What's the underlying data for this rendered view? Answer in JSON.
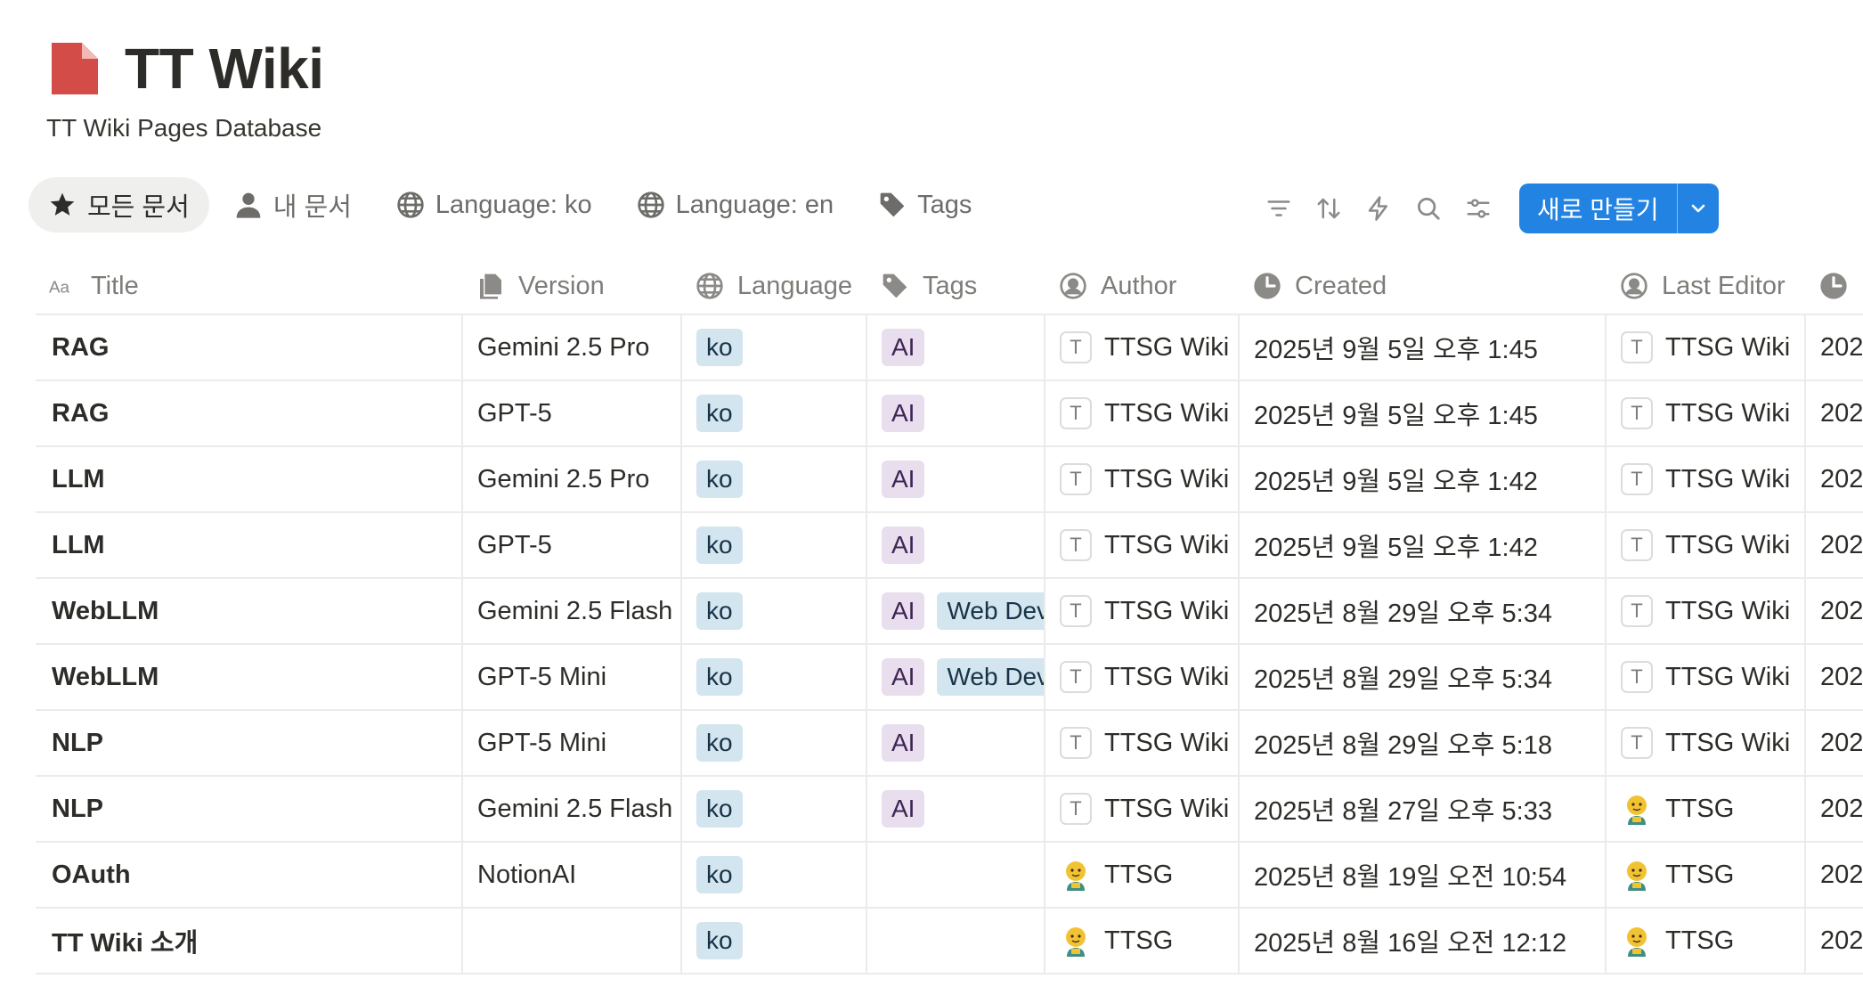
{
  "page": {
    "title": "TT Wiki",
    "subtitle": "TT Wiki Pages Database",
    "icon": "page-icon",
    "icon_color": "#d44c47"
  },
  "views": [
    {
      "label": "모든 문서",
      "icon": "star-icon",
      "active": true
    },
    {
      "label": "내 문서",
      "icon": "person-icon",
      "active": false
    },
    {
      "label": "Language: ko",
      "icon": "globe-icon",
      "active": false
    },
    {
      "label": "Language: en",
      "icon": "globe-icon",
      "active": false
    },
    {
      "label": "Tags",
      "icon": "tag-icon",
      "active": false
    }
  ],
  "toolbar": {
    "icons": [
      "filter-icon",
      "sort-icon",
      "automation-icon",
      "search-icon",
      "settings-icon"
    ],
    "new_label": "새로 만들기",
    "accent": "#2383e2"
  },
  "columns": {
    "title": "Title",
    "version": "Version",
    "language": "Language",
    "tags": "Tags",
    "author": "Author",
    "created": "Created",
    "last_editor": "Last Editor"
  },
  "rows": [
    {
      "title": "RAG",
      "version": "Gemini 2.5 Pro",
      "language": "ko",
      "tags": [
        "AI"
      ],
      "author": "TTSG Wiki",
      "author_avatar": "T",
      "created": "2025년 9월 5일 오후 1:45",
      "editor": "TTSG Wiki",
      "editor_avatar": "T",
      "next": "202"
    },
    {
      "title": "RAG",
      "version": "GPT-5",
      "language": "ko",
      "tags": [
        "AI"
      ],
      "author": "TTSG Wiki",
      "author_avatar": "T",
      "created": "2025년 9월 5일 오후 1:45",
      "editor": "TTSG Wiki",
      "editor_avatar": "T",
      "next": "202"
    },
    {
      "title": "LLM",
      "version": "Gemini 2.5 Pro",
      "language": "ko",
      "tags": [
        "AI"
      ],
      "author": "TTSG Wiki",
      "author_avatar": "T",
      "created": "2025년 9월 5일 오후 1:42",
      "editor": "TTSG Wiki",
      "editor_avatar": "T",
      "next": "202"
    },
    {
      "title": "LLM",
      "version": "GPT-5",
      "language": "ko",
      "tags": [
        "AI"
      ],
      "author": "TTSG Wiki",
      "author_avatar": "T",
      "created": "2025년 9월 5일 오후 1:42",
      "editor": "TTSG Wiki",
      "editor_avatar": "T",
      "next": "202"
    },
    {
      "title": "WebLLM",
      "version": "Gemini 2.5 Flash",
      "language": "ko",
      "tags": [
        "AI",
        "Web Dev"
      ],
      "author": "TTSG Wiki",
      "author_avatar": "T",
      "created": "2025년 8월 29일 오후 5:34",
      "editor": "TTSG Wiki",
      "editor_avatar": "T",
      "next": "202"
    },
    {
      "title": "WebLLM",
      "version": "GPT-5 Mini",
      "language": "ko",
      "tags": [
        "AI",
        "Web Dev"
      ],
      "author": "TTSG Wiki",
      "author_avatar": "T",
      "created": "2025년 8월 29일 오후 5:34",
      "editor": "TTSG Wiki",
      "editor_avatar": "T",
      "next": "202"
    },
    {
      "title": "NLP",
      "version": "GPT-5 Mini",
      "language": "ko",
      "tags": [
        "AI"
      ],
      "author": "TTSG Wiki",
      "author_avatar": "T",
      "created": "2025년 8월 29일 오후 5:18",
      "editor": "TTSG Wiki",
      "editor_avatar": "T",
      "next": "202"
    },
    {
      "title": "NLP",
      "version": "Gemini 2.5 Flash",
      "language": "ko",
      "tags": [
        "AI"
      ],
      "author": "TTSG Wiki",
      "author_avatar": "T",
      "created": "2025년 8월 27일 오후 5:33",
      "editor": "TTSG",
      "editor_avatar": "face",
      "next": "202"
    },
    {
      "title": "OAuth",
      "version": "NotionAI",
      "language": "ko",
      "tags": [],
      "author": "TTSG",
      "author_avatar": "face",
      "created": "2025년 8월 19일 오전 10:54",
      "editor": "TTSG",
      "editor_avatar": "face",
      "next": "202"
    },
    {
      "title": "TT Wiki 소개",
      "version": "",
      "language": "ko",
      "tags": [],
      "author": "TTSG",
      "author_avatar": "face",
      "created": "2025년 8월 16일 오전 12:12",
      "editor": "TTSG",
      "editor_avatar": "face",
      "next": "202"
    }
  ]
}
